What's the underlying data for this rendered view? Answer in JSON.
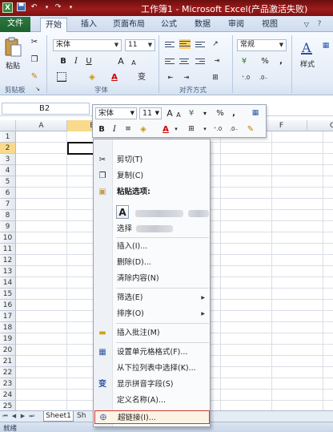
{
  "window": {
    "title": "工作簿1 - Microsoft Excel(产品激活失败)",
    "app_icon": "X"
  },
  "tabs": [
    {
      "label": "文件"
    },
    {
      "label": "开始"
    },
    {
      "label": "插入"
    },
    {
      "label": "页面布局"
    },
    {
      "label": "公式"
    },
    {
      "label": "数据"
    },
    {
      "label": "审阅"
    },
    {
      "label": "视图"
    }
  ],
  "ribbon": {
    "paste_label": "粘贴",
    "groups": {
      "clipboard": "剪贴板",
      "font": "字体",
      "alignment": "对齐方式",
      "styles_btn": "样式"
    },
    "font_name": "宋体",
    "font_size": "11",
    "number_format": "常规",
    "bold": "B",
    "italic": "I",
    "underline": "U",
    "font_inc": "A",
    "font_dec": "A",
    "percent": "%",
    "comma": ",",
    "phonetic": "变"
  },
  "formula_bar": {
    "name_box": "B2"
  },
  "grid": {
    "columns": [
      "A",
      "B",
      "C",
      "D",
      "E",
      "F",
      "G"
    ],
    "rows": [
      "1",
      "2",
      "3",
      "4",
      "5",
      "6",
      "7",
      "8",
      "9",
      "10",
      "11",
      "12",
      "13",
      "14",
      "15",
      "16",
      "17",
      "18",
      "19",
      "20",
      "21",
      "22",
      "23",
      "24",
      "25"
    ],
    "selected_row": "2",
    "partial_values": [
      "1",
      "2",
      "3"
    ]
  },
  "mini_toolbar": {
    "font_name": "宋体",
    "font_size": "11",
    "font_inc": "A",
    "font_dec": "A",
    "percent": "%",
    "comma": ",",
    "bold": "B",
    "italic": "I"
  },
  "context_menu": {
    "items": [
      {
        "label": "剪切(T)"
      },
      {
        "label": "复制(C)"
      },
      {
        "label": "粘贴选项:"
      },
      {
        "label": "选择"
      },
      {
        "label": "插入(I)..."
      },
      {
        "label": "删除(D)..."
      },
      {
        "label": "清除内容(N)"
      },
      {
        "label": "筛选(E)"
      },
      {
        "label": "排序(O)"
      },
      {
        "label": "插入批注(M)"
      },
      {
        "label": "设置单元格格式(F)..."
      },
      {
        "label": "从下拉列表中选择(K)..."
      },
      {
        "label": "显示拼音字段(S)"
      },
      {
        "label": "定义名称(A)..."
      },
      {
        "label": "超链接(I)..."
      }
    ],
    "paste_option": "A"
  },
  "sheets": {
    "sheet1": "Sheet1",
    "sheet2": "Sh"
  },
  "status": {
    "text": "就绪"
  },
  "colors": {
    "title_bar": "#9e1b1b",
    "file_tab": "#2c7a3e",
    "selection_header": "#f9d98b",
    "highlight_border": "#d23a2e"
  }
}
